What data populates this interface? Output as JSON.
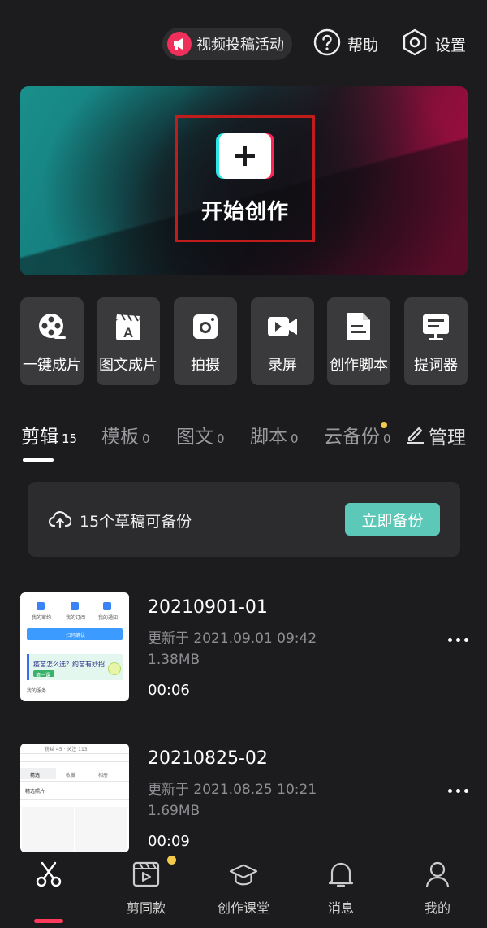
{
  "header": {
    "event_label": "视频投稿活动",
    "help_label": "帮助",
    "settings_label": "设置"
  },
  "hero": {
    "create_label": "开始创作",
    "colors": {
      "teal": "#1a8f8c",
      "crimson": "#a80f42",
      "highlight_border": "#c01c1c"
    }
  },
  "tools": [
    {
      "label": "一键成片",
      "icon": "film-reel-icon"
    },
    {
      "label": "图文成片",
      "icon": "text-to-video-icon"
    },
    {
      "label": "拍摄",
      "icon": "camera-icon"
    },
    {
      "label": "录屏",
      "icon": "screen-record-icon"
    },
    {
      "label": "创作脚本",
      "icon": "script-document-icon"
    },
    {
      "label": "提词器",
      "icon": "teleprompter-icon"
    }
  ],
  "tabs": [
    {
      "label": "剪辑",
      "count": "15",
      "active": true
    },
    {
      "label": "模板",
      "count": "0"
    },
    {
      "label": "图文",
      "count": "0"
    },
    {
      "label": "脚本",
      "count": "0"
    },
    {
      "label": "云备份",
      "count": "0"
    }
  ],
  "manage_label": "管理",
  "backup": {
    "message": "15个草稿可备份",
    "button_label": "立即备份",
    "button_color": "#5cc8b8"
  },
  "drafts": [
    {
      "title": "20210901-01",
      "updated": "更新于 2021.09.01 09:42",
      "size": "1.38MB",
      "duration": "00:06",
      "thumb": {
        "items": [
          "我的审约",
          "我的订阅",
          "我的通知"
        ],
        "bar": "扫码确认",
        "promo": "疫苗怎么选？约苗有妙招",
        "promo_btn": "第一课",
        "footer": "我的服务"
      }
    },
    {
      "title": "20210825-02",
      "updated": "更新于 2021.08.25 10:21",
      "size": "1.69MB",
      "duration": "00:09",
      "thumb": {
        "stats": "粉丝 45 · 关注 113",
        "tabs": [
          "精选",
          "收藏",
          "相册"
        ],
        "section": "精选照片"
      }
    }
  ],
  "bottom_nav": [
    {
      "label": "",
      "icon": "scissors-icon",
      "active": true
    },
    {
      "label": "剪同款",
      "icon": "template-clapper-icon"
    },
    {
      "label": "创作课堂",
      "icon": "graduation-cap-icon"
    },
    {
      "label": "消息",
      "icon": "bell-icon"
    },
    {
      "label": "我的",
      "icon": "profile-icon"
    }
  ],
  "accent": {
    "active_indicator": "#ff3b5c",
    "notify_dot": "#f5c94a"
  }
}
